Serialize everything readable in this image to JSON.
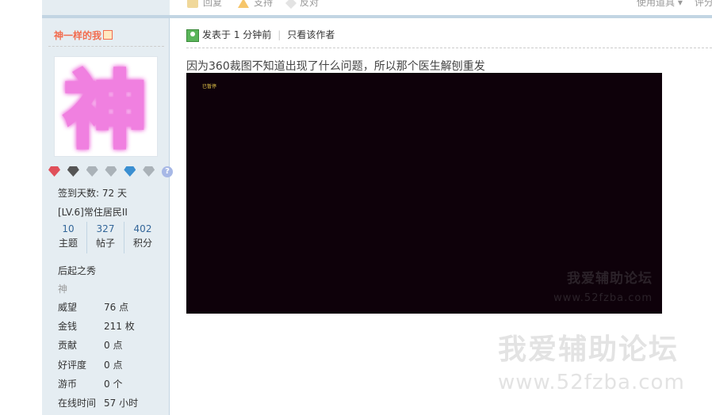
{
  "top_actions": {
    "reply": "回复",
    "support": "支持",
    "oppose": "反对",
    "tools": "使用道具",
    "rate": "评分"
  },
  "user": {
    "name": "神一样的我",
    "avatar_char": "神",
    "signin_days": "签到天数: 72 天",
    "level": "[LV.6]常住居民II",
    "stats": [
      {
        "num": "10",
        "label": "主题"
      },
      {
        "num": "327",
        "label": "帖子"
      },
      {
        "num": "402",
        "label": "积分"
      }
    ],
    "rank": "后起之秀",
    "custom_title": "神",
    "details": [
      {
        "k": "威望",
        "v": "76 点"
      },
      {
        "k": "金钱",
        "v": "211 枚"
      },
      {
        "k": "贡献",
        "v": "0 点"
      },
      {
        "k": "好评度",
        "v": "0 点"
      },
      {
        "k": "游币",
        "v": "0 个"
      },
      {
        "k": "在线时间",
        "v": "57 小时"
      }
    ],
    "medal_help": "?"
  },
  "post": {
    "posted": "发表于 1 分钟前",
    "author_only": "只看该作者",
    "text": "因为360裁图不知道出现了什么问题，所以那个医生解刨重发",
    "image": {
      "paused_label": "已暂停",
      "watermark_cn": "我爱辅助论坛",
      "watermark_url": "www.52fzba.com"
    }
  },
  "page_watermark": {
    "cn": "我爱辅助论坛",
    "url": "www.52fzba.com"
  },
  "colors": {
    "sidebar_bg": "#e5edf2",
    "border": "#c2d5e3",
    "username": "#f26c4f",
    "stat_num": "#336699",
    "screenshot_bg": "#0e010a"
  }
}
